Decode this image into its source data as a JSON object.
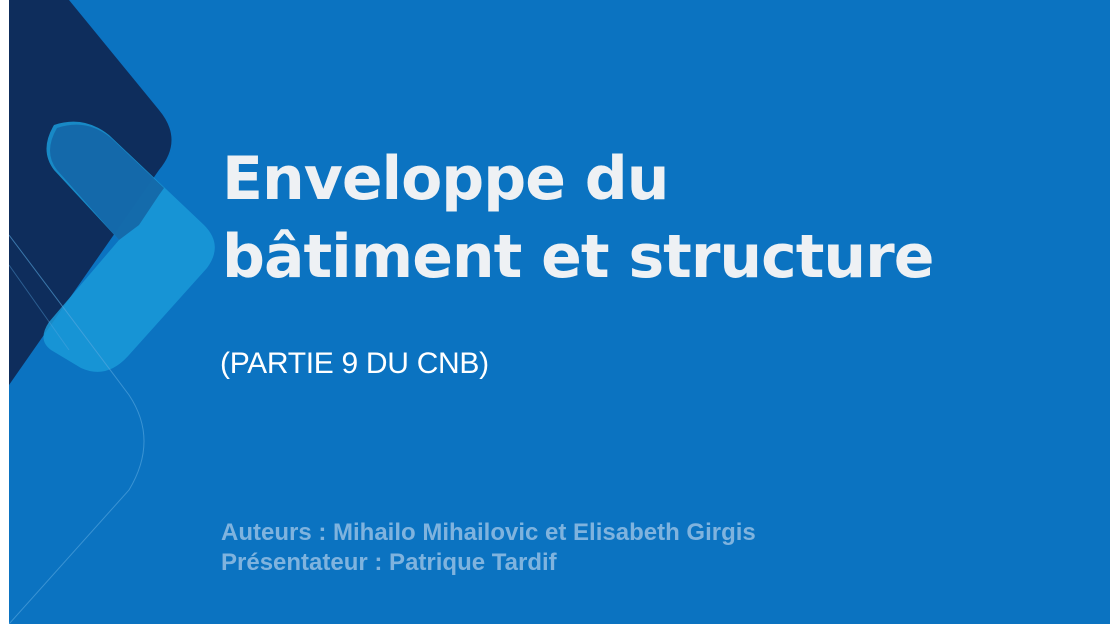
{
  "slide": {
    "title_line1": "Enveloppe du",
    "title_line2": "bâtiment et structure",
    "subtitle": "(PARTIE 9 DU CNB)",
    "authors": "Auteurs : Mihailo Mihailovic et Elisabeth Girgis",
    "presenter": "Présentateur : Patrique Tardif"
  },
  "colors": {
    "background": "#0b73c1",
    "navy_shape": "#0e2d5c",
    "light_blue_shape": "#1a9ad8",
    "title_text": "#eef1f4",
    "credits_text": "#7fb3de"
  }
}
